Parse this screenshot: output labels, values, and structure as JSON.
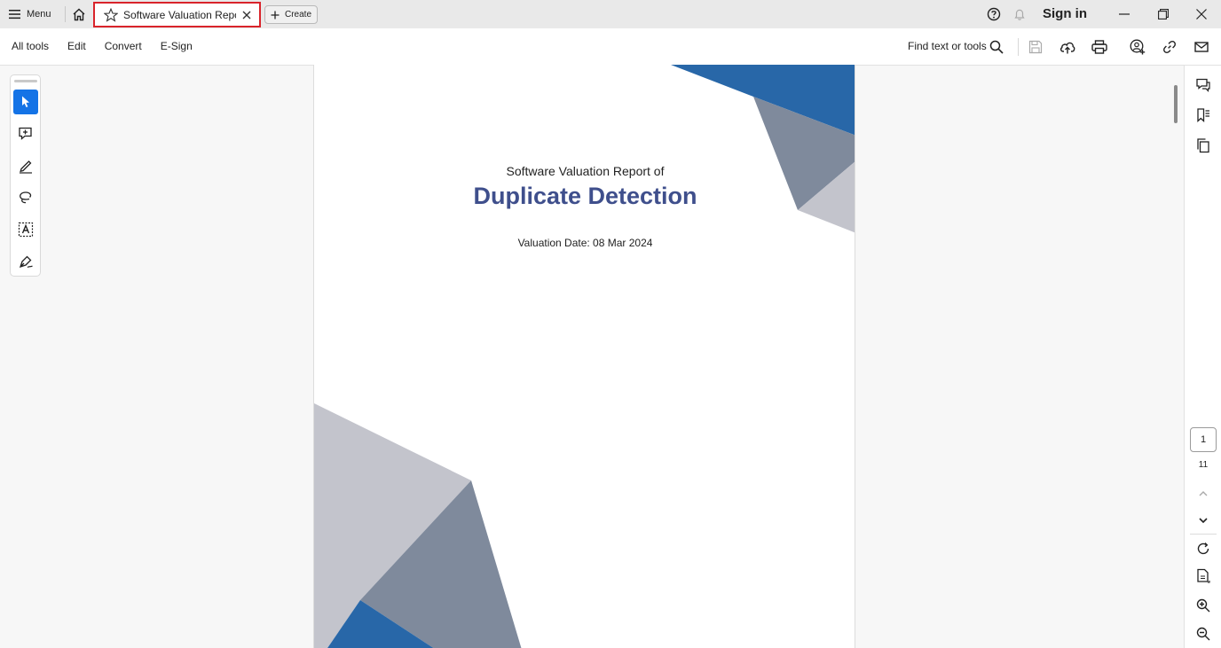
{
  "titlebar": {
    "menu_label": "Menu",
    "tab_title": "Software Valuation Repo...",
    "create_label": "Create",
    "signin_label": "Sign in"
  },
  "toolbar": {
    "nav": [
      "All tools",
      "Edit",
      "Convert",
      "E-Sign"
    ],
    "find_label": "Find text or tools"
  },
  "document": {
    "subtitle": "Software Valuation Report of",
    "title": "Duplicate Detection",
    "valuation_date": "Valuation Date: 08 Mar 2024",
    "colors": {
      "blue": "#2867a8",
      "slate": "#7f8a9c",
      "light": "#c3c4cc",
      "title": "#3f4f8c"
    }
  },
  "pagenav": {
    "current_page": "1",
    "total_pages": "11"
  },
  "accent": {
    "tab_border": "#d9242b",
    "active_tool": "#1473e6"
  }
}
